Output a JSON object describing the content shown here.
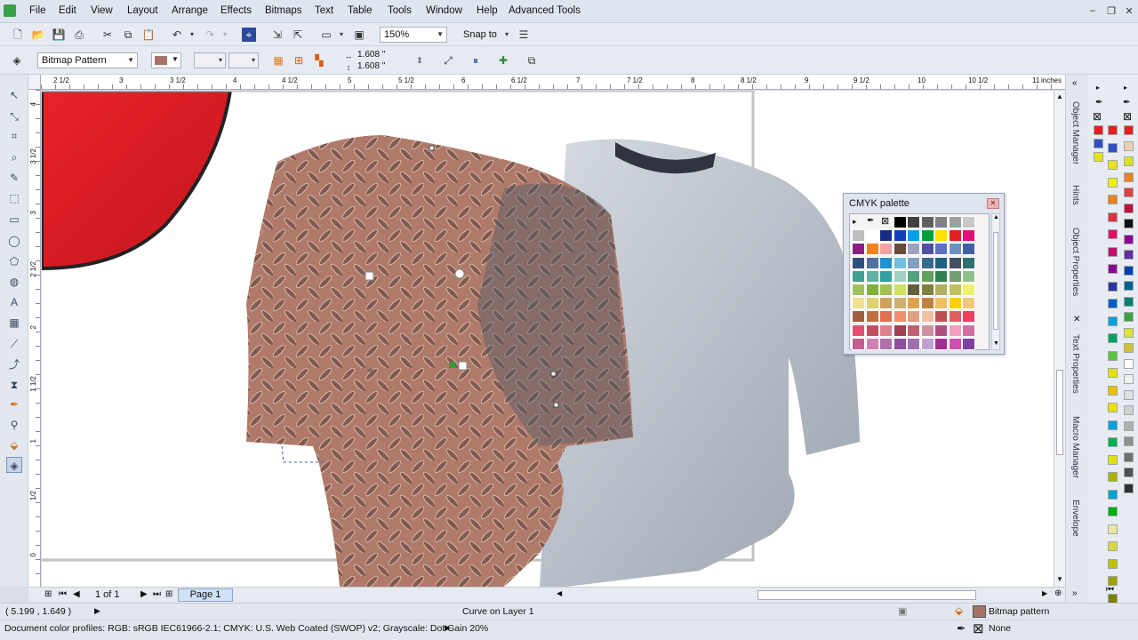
{
  "menu": {
    "items": [
      "File",
      "Edit",
      "View",
      "Layout",
      "Arrange",
      "Effects",
      "Bitmaps",
      "Text",
      "Table",
      "Tools",
      "Window",
      "Help",
      "Advanced Tools"
    ]
  },
  "toolbar": {
    "zoom_value": "150%",
    "snap_label": "Snap to"
  },
  "property_bar": {
    "fill_type": "Bitmap Pattern",
    "width_value": "1.608 \"",
    "height_value": "1.608 \""
  },
  "ruler": {
    "unit": "inches",
    "top_labels": [
      "2 1/2",
      "3",
      "3 1/2",
      "4",
      "4 1/2",
      "5",
      "5 1/2",
      "6",
      "6 1/2",
      "7",
      "7 1/2",
      "8",
      "8 1/2",
      "9",
      "9 1/2",
      "10",
      "10 1/2",
      "11"
    ],
    "left_labels": [
      "4",
      "3 1/2",
      "3",
      "2 1/2",
      "2",
      "1 1/2",
      "1",
      "1/2",
      "0"
    ]
  },
  "page_nav": {
    "page_count": "1 of 1",
    "page_tab": "Page 1"
  },
  "status": {
    "coords": "( 5.199 , 1.649 )",
    "object_info": "Curve on Layer 1",
    "color_profiles": "Document color profiles: RGB: sRGB IEC61966-2.1; CMYK: U.S. Web Coated (SWOP) v2; Grayscale: Dot Gain 20%",
    "fill_label": "Bitmap pattern",
    "outline_label": "None"
  },
  "dockers": {
    "tabs": [
      "Object Manager",
      "Hints",
      "Object Properties",
      "Text Properties",
      "Macro Manager",
      "Envelope"
    ]
  },
  "cmyk_palette": {
    "title": "CMYK palette",
    "swatches": [
      "#d8d8d8",
      "#c0c0c0",
      "#ffffff",
      "#000000",
      "#404040",
      "#606060",
      "#808080",
      "#a0a0a0",
      "#c8c8c8",
      "#bfbfbf",
      "#ffffff",
      "#1a2a8a",
      "#1040c0",
      "#00a0e8",
      "#00a040",
      "#ffe000",
      "#e02020",
      "#e0107a",
      "#8a2080",
      "#f08020",
      "#f4a0a0",
      "#6a4a3a",
      "#a0a0c0",
      "#5050a0",
      "#6070c0",
      "#7090c0",
      "#4060a0",
      "#305080",
      "#5070a0",
      "#2090d0",
      "#70c0e0",
      "#80a0c0",
      "#3a6a8a",
      "#206080",
      "#405060",
      "#307070",
      "#40a090",
      "#60b0a0",
      "#30a0a0",
      "#a0d0c0",
      "#50a080",
      "#60a060",
      "#308050",
      "#70a070",
      "#90c090",
      "#a0c060",
      "#80b040",
      "#a0c050",
      "#d0e060",
      "#60603a",
      "#808040",
      "#b0b060",
      "#c0c060",
      "#f0f070",
      "#f0e090",
      "#e0d070",
      "#d0a060",
      "#d0b070",
      "#e0a050",
      "#c08040",
      "#f0c060",
      "#ffd000",
      "#f0c880",
      "#a06040",
      "#c07040",
      "#e07050",
      "#f09070",
      "#e0a080",
      "#f0c0a0",
      "#c05050",
      "#e06060",
      "#f04060",
      "#e05070",
      "#c05060",
      "#e08090",
      "#a04050",
      "#c06070",
      "#d090a0",
      "#b05080",
      "#f0a0c0",
      "#d070a0",
      "#c06090",
      "#d080b0",
      "#b070b0",
      "#9050a0",
      "#a070b0",
      "#c0a0d0",
      "#a03090",
      "#d050b0",
      "#8040a0"
    ]
  },
  "side_palette": {
    "col1": [
      "#e02020",
      "#3050c0",
      "#e8e020",
      "#f0f000",
      "#f08020",
      "#e03040",
      "#e01060",
      "#c01070",
      "#900090",
      "#3030a0",
      "#0060c0",
      "#00a0e0",
      "#00a060",
      "#60c040",
      "#e8e000",
      "#f0c000",
      "#f0e000",
      "#00a0e0",
      "#00b050",
      "#e0e000",
      "#b0b000",
      "#00a0d0",
      "#00b000",
      "#e8e8a0",
      "#d8d840",
      "#c0c000",
      "#a0a000",
      "#808000"
    ],
    "col2": [
      "#e02020",
      "#f0d0b0",
      "#e0e020",
      "#f08020",
      "#e04040",
      "#c01040",
      "#101010",
      "#900090",
      "#6030a0",
      "#0040b0",
      "#006090",
      "#008070",
      "#40a040",
      "#e0e040",
      "#d0c040",
      "#ffffff",
      "#f0f0f0",
      "#e0e0e0",
      "#d0d0d0",
      "#b0b0b0",
      "#909090",
      "#707070",
      "#505050",
      "#303030"
    ]
  }
}
